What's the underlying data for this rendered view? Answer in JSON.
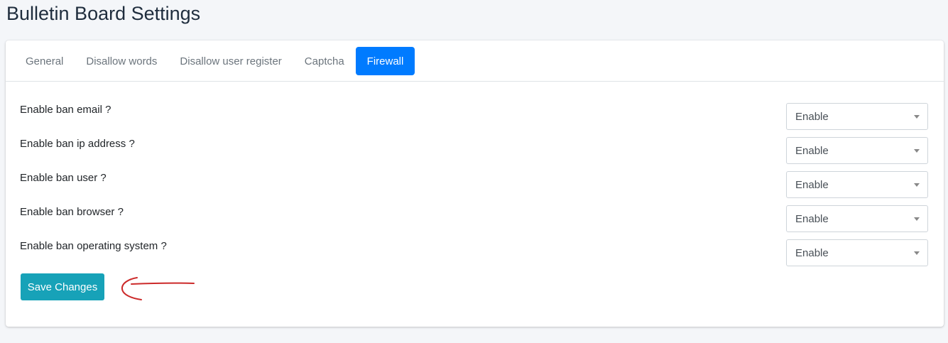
{
  "page": {
    "title": "Bulletin Board Settings"
  },
  "tabs": [
    {
      "label": "General"
    },
    {
      "label": "Disallow words"
    },
    {
      "label": "Disallow user register"
    },
    {
      "label": "Captcha"
    },
    {
      "label": "Firewall",
      "active": true
    }
  ],
  "settings": [
    {
      "label": "Enable ban email ?",
      "value": "Enable"
    },
    {
      "label": "Enable ban ip address ?",
      "value": "Enable"
    },
    {
      "label": "Enable ban user ?",
      "value": "Enable"
    },
    {
      "label": "Enable ban browser ?",
      "value": "Enable"
    },
    {
      "label": "Enable ban operating system ?",
      "value": "Enable"
    }
  ],
  "actions": {
    "save_label": "Save Changes"
  },
  "colors": {
    "active_tab": "#007bff",
    "save_button": "#17a2b8",
    "annotation_arrow": "#cc2a2a"
  }
}
